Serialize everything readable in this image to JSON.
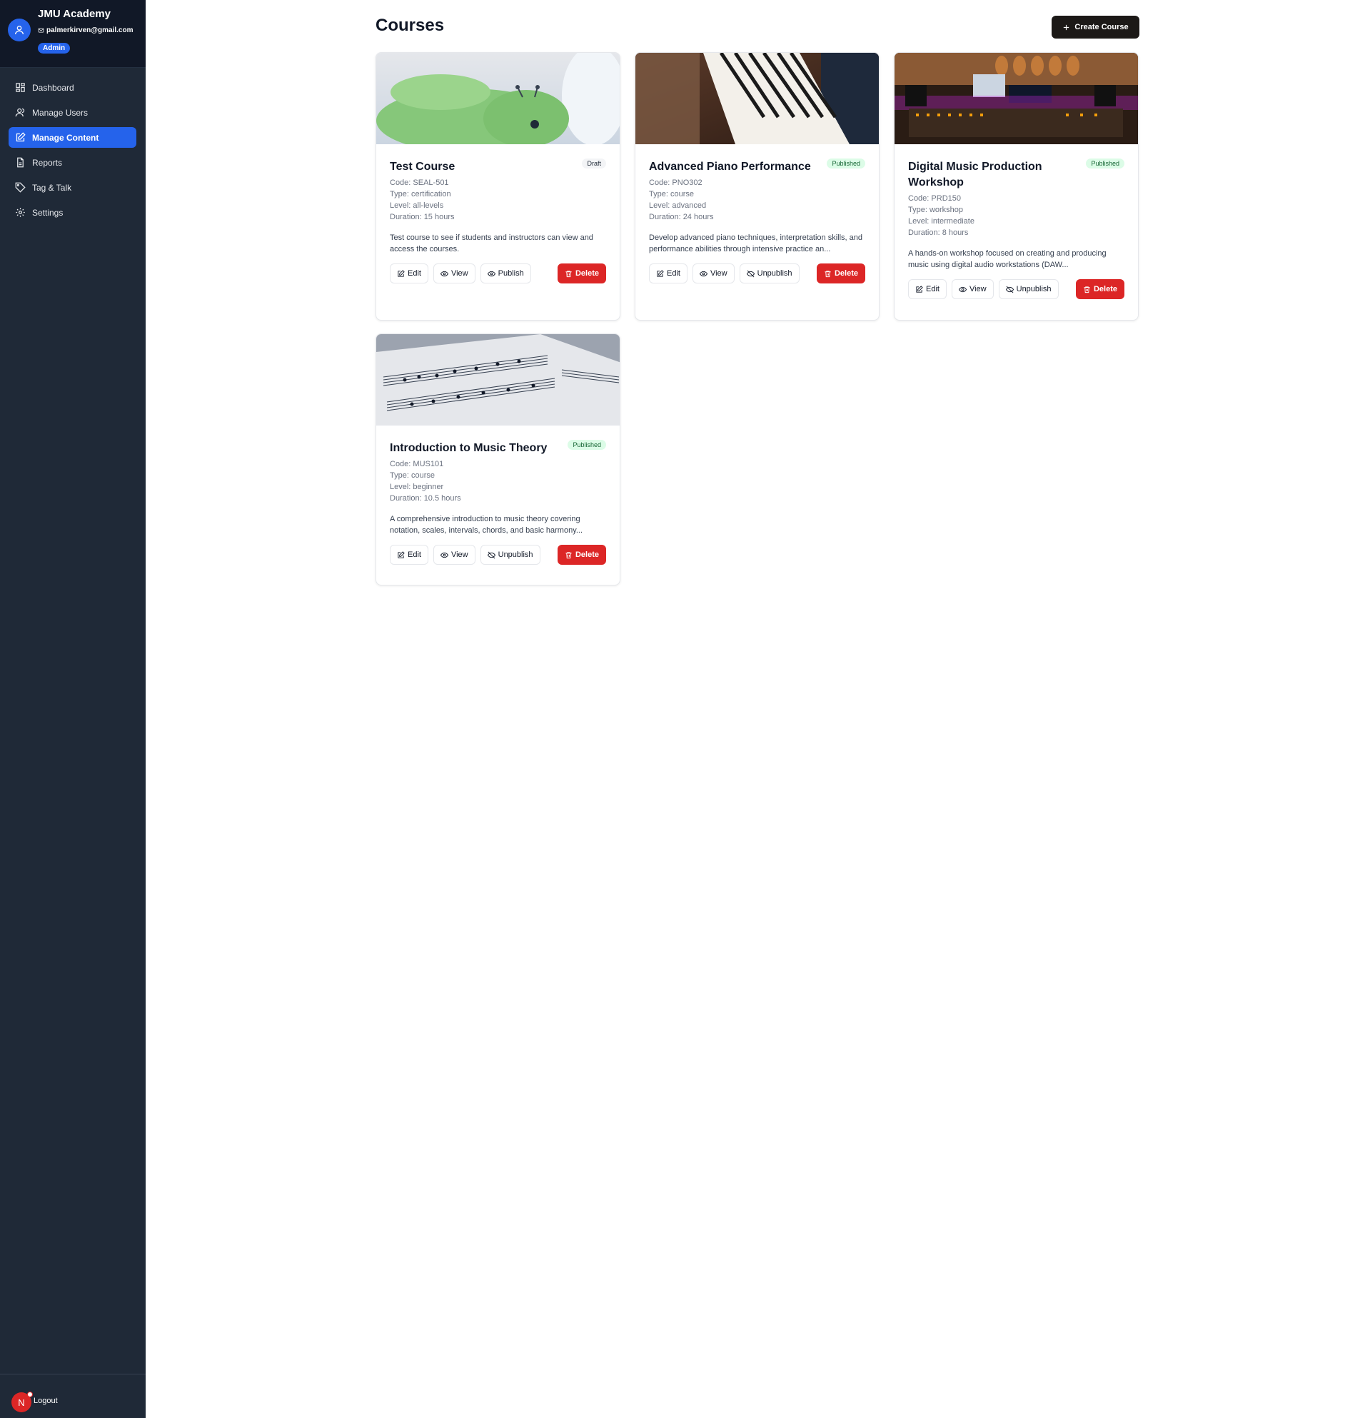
{
  "sidebar": {
    "app_name": "JMU Academy",
    "email": "palmerkirven@gmail.com",
    "role": "Admin",
    "items": [
      {
        "label": "Dashboard",
        "icon": "dashboard-icon"
      },
      {
        "label": "Manage Users",
        "icon": "users-icon"
      },
      {
        "label": "Manage Content",
        "icon": "edit-icon",
        "active": true
      },
      {
        "label": "Reports",
        "icon": "file-icon"
      },
      {
        "label": "Tag & Talk",
        "icon": "tag-icon"
      },
      {
        "label": "Settings",
        "icon": "gear-icon"
      }
    ],
    "user_initial": "N",
    "logout_label": "Logout"
  },
  "main": {
    "title": "Courses",
    "create_label": "Create Course"
  },
  "labels": {
    "edit": "Edit",
    "view": "View",
    "delete": "Delete"
  },
  "courses": [
    {
      "title": "Test Course",
      "status": "Draft",
      "code": "Code: SEAL-501",
      "type": "Type: certification",
      "level": "Level: all-levels",
      "duration": "Duration: 15 hours",
      "description": "Test course to see if students and instructors can view and access the courses.",
      "toggle_label": "Publish",
      "image": "green-seal-image"
    },
    {
      "title": "Advanced Piano Performance",
      "status": "Published",
      "code": "Code: PNO302",
      "type": "Type: course",
      "level": "Level: advanced",
      "duration": "Duration: 24 hours",
      "description": "Develop advanced piano techniques, interpretation skills, and performance abilities through intensive practice an...",
      "toggle_label": "Unpublish",
      "image": "piano-keys-image"
    },
    {
      "title": "Digital Music Production Workshop",
      "status": "Published",
      "code": "Code: PRD150",
      "type": "Type: workshop",
      "level": "Level: intermediate",
      "duration": "Duration: 8 hours",
      "description": "A hands-on workshop focused on creating and producing music using digital audio workstations (DAW...",
      "toggle_label": "Unpublish",
      "image": "studio-image"
    },
    {
      "title": "Introduction to Music Theory",
      "status": "Published",
      "code": "Code: MUS101",
      "type": "Type: course",
      "level": "Level: beginner",
      "duration": "Duration: 10.5 hours",
      "description": "A comprehensive introduction to music theory covering notation, scales, intervals, chords, and basic harmony...",
      "toggle_label": "Unpublish",
      "image": "sheet-music-image"
    }
  ],
  "colors": {
    "sidebar_bg": "#1f2937",
    "accent": "#2563eb",
    "danger": "#dc2626",
    "published_bg": "#dcfce7",
    "published_text": "#166534"
  }
}
